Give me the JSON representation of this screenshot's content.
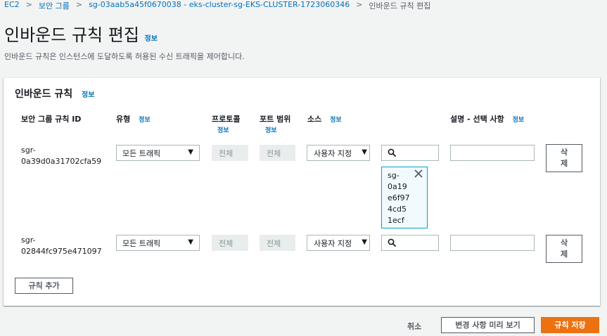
{
  "breadcrumbs": {
    "items": [
      "EC2",
      "보안 그룹",
      "sg-03aab5a45f0670038 - eks-cluster-sg-EKS-CLUSTER-1723060346",
      "인바운드 규칙 편집"
    ],
    "separator": ">"
  },
  "page": {
    "title": "인바운드 규칙 편집",
    "info_link": "정보",
    "description": "인바운드 규칙은 인스턴스에 도달하도록 허용된 수신 트래픽을 제어합니다."
  },
  "panel": {
    "title": "인바운드 규칙",
    "info_link": "정보",
    "columns": {
      "rule_id": "보안 그룹 규칙 ID",
      "type": "유형",
      "type_info": "정보",
      "protocol": "프로토콜",
      "protocol_info": "정보",
      "port_range": "포트 범위",
      "port_range_info": "정보",
      "source": "소스",
      "source_info": "정보",
      "description": "설명 - 선택 사항",
      "description_info": "정보"
    },
    "rows": [
      {
        "rule_id_line1": "sgr-",
        "rule_id_line2": "0a39d0a31702cfa59",
        "type": "모든 트래픽",
        "protocol": "전체",
        "port_range": "전체",
        "source": "사용자 지정",
        "source_search": "",
        "source_token": [
          "sg-",
          "0a19",
          "e6f97",
          "4cd5",
          "1ecf"
        ],
        "description": "",
        "delete_label_1": "삭",
        "delete_label_2": "제"
      },
      {
        "rule_id_line1": "sgr-",
        "rule_id_line2": "02844fc975e471097",
        "type": "모든 트래픽",
        "protocol": "전체",
        "port_range": "전체",
        "source": "사용자 지정",
        "source_search": "",
        "description": "",
        "delete_label_1": "삭",
        "delete_label_2": "제"
      }
    ],
    "add_rule_label": "규칙 추가"
  },
  "footer": {
    "cancel_label": "취소",
    "preview_label": "변경 사항 미리 보기",
    "save_label": "규칙 저장"
  },
  "colors": {
    "link": "#0073bb",
    "primary_button": "#ec7211",
    "token_border": "#00a1c9",
    "token_bg": "#f1faff"
  },
  "icons": {
    "search": "search-icon",
    "caret": "caret-down-icon",
    "close": "close-icon",
    "chevron": "chevron-right-icon"
  }
}
